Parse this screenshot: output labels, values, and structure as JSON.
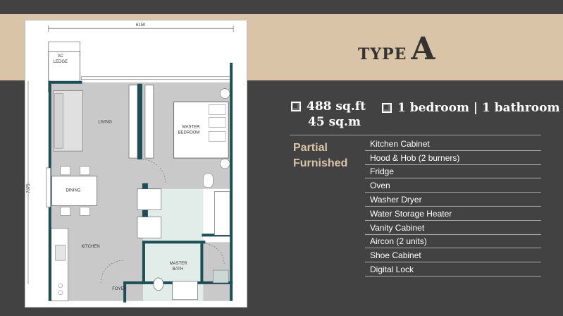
{
  "header": {
    "type_word": "TYPE",
    "type_letter": "A"
  },
  "specs": {
    "area_sqft": "488 sq.ft",
    "area_sqm": "45 sq.m",
    "rooms": "1 bedroom | 1 bathroom"
  },
  "furnishing": {
    "line1": "Partial",
    "line2": "Furnished"
  },
  "features": [
    "Kitchen Cabinet",
    "Hood & Hob (2 burners)",
    "Fridge",
    "Oven",
    "Washer Dryer",
    "Water Storage Heater",
    "Vanity Cabinet",
    "Aircon (2 units)",
    "Shoe Cabinet",
    "Digital Lock"
  ],
  "plan": {
    "width_dim": "6150",
    "height_dim": "7375",
    "rooms": {
      "ac": "AC",
      "ledge": "LEDGE",
      "living": "LIVING",
      "master": "MASTER",
      "bedroom": "BEDROOM",
      "dining": "DINING",
      "kitchen": "KITCHEN",
      "master_bath_1": "MASTER",
      "master_bath_2": "BATH",
      "foyer": "FOYER"
    }
  },
  "colors": {
    "band": "#d9c4a8",
    "background": "#424242",
    "wall": "#1d4e55",
    "accent": "#d9c4a8"
  }
}
